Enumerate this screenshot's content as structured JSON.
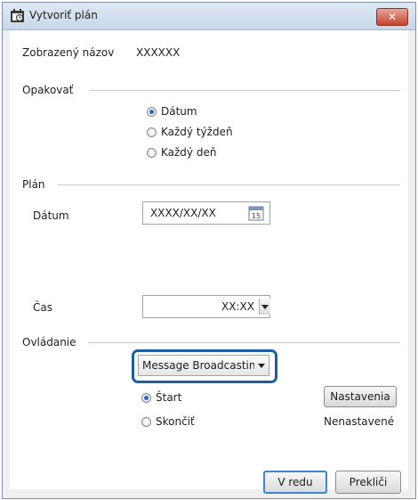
{
  "window": {
    "title": "Vytvoriť plán",
    "close_label": "✕"
  },
  "display_name": {
    "label": "Zobrazený názov",
    "value": "XXXXXX"
  },
  "repeat": {
    "section_label": "Opakovať",
    "options": [
      {
        "label": "Dátum",
        "selected": true
      },
      {
        "label": "Každý týždeň",
        "selected": false
      },
      {
        "label": "Každý deň",
        "selected": false
      }
    ]
  },
  "plan": {
    "section_label": "Plán",
    "date_label": "Dátum",
    "date_value": "XXXX/XX/XX",
    "calendar_icon_text": "15",
    "time_label": "Čas",
    "time_value": "XX:XX"
  },
  "control": {
    "section_label": "Ovládanie",
    "dropdown_value": "Message Broadcastinç",
    "start_label": "Štart",
    "end_label": "Skončiť",
    "settings_button": "Nastavenia",
    "status": "Nenastavené"
  },
  "footer": {
    "ok_label": "V redu",
    "cancel_label": "Prekliči"
  },
  "colors": {
    "highlight": "#1c5fa1",
    "accent": "#3c86d6"
  }
}
